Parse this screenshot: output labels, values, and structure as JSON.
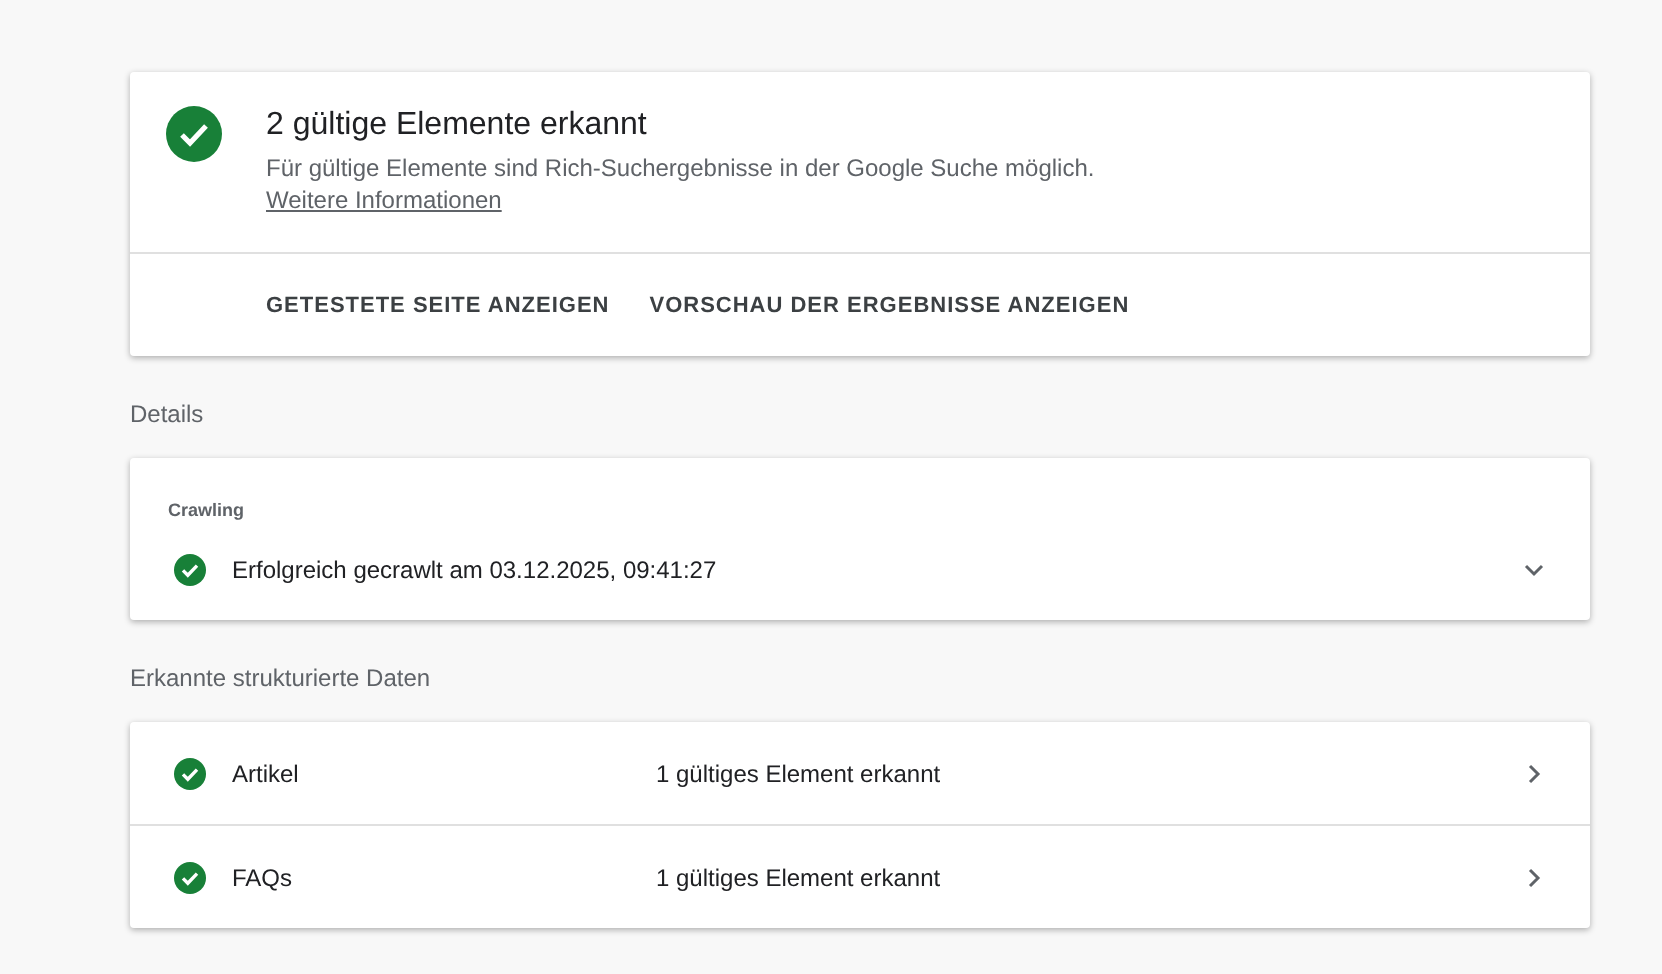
{
  "summary": {
    "title": "2 gültige Elemente erkannt",
    "description": "Für gültige Elemente sind Rich-Suchergebnisse in der Google Suche möglich.",
    "link": "Weitere Informationen",
    "actions": [
      "GETESTETE SEITE ANZEIGEN",
      "VORSCHAU DER ERGEBNISSE ANZEIGEN"
    ]
  },
  "details": {
    "heading": "Details",
    "section": "Crawling",
    "status": "Erfolgreich gecrawlt am 03.12.2025, 09:41:27",
    "expanded": false
  },
  "structured_data": {
    "heading": "Erkannte strukturierte Daten",
    "rows": [
      {
        "type": "Artikel",
        "result": "1 gültiges Element erkannt"
      },
      {
        "type": "FAQs",
        "result": "1 gültiges Element erkannt"
      }
    ]
  }
}
